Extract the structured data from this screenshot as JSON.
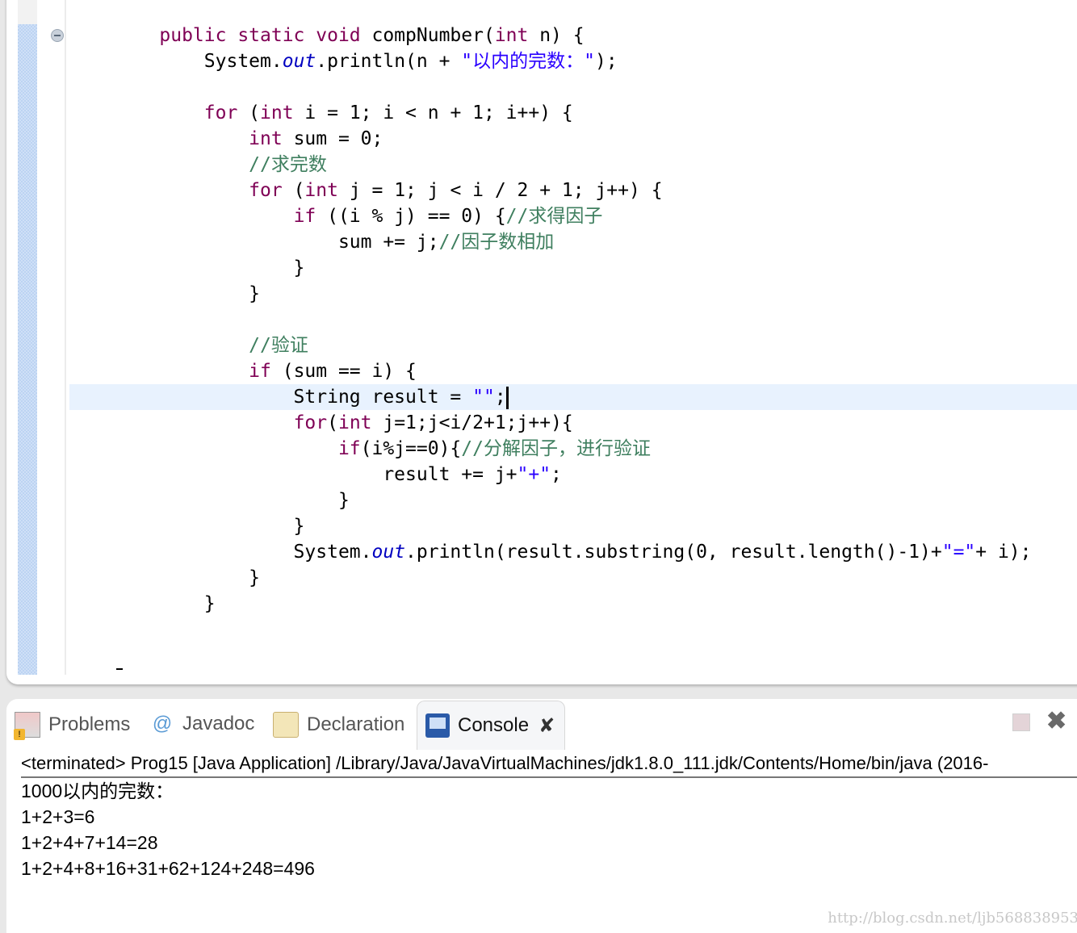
{
  "colors": {
    "keyword": "#7f0055",
    "string": "#2a00ff",
    "comment": "#3f7f5f",
    "field": "#0000c0",
    "current_line": "#e8f2fe"
  },
  "editor": {
    "current_line": 14,
    "lines": [
      [
        [
          "",
          "    "
        ],
        [
          "kw",
          "public static void"
        ],
        [
          "",
          " compNumber("
        ],
        [
          "kw",
          "int"
        ],
        [
          "",
          " n) {"
        ]
      ],
      [
        [
          "",
          "        System."
        ],
        [
          "fld",
          "out"
        ],
        [
          "",
          ".println(n + "
        ],
        [
          "str",
          "\"以内的完数：\""
        ],
        [
          "",
          ");"
        ]
      ],
      [],
      [
        [
          "",
          "        "
        ],
        [
          "kw",
          "for"
        ],
        [
          "",
          " ("
        ],
        [
          "kw",
          "int"
        ],
        [
          "",
          " i = 1; i < n + 1; i++) {"
        ]
      ],
      [
        [
          "",
          "            "
        ],
        [
          "kw",
          "int"
        ],
        [
          "",
          " sum = 0;"
        ]
      ],
      [
        [
          "",
          "            "
        ],
        [
          "cmt",
          "//求完数"
        ]
      ],
      [
        [
          "",
          "            "
        ],
        [
          "kw",
          "for"
        ],
        [
          "",
          " ("
        ],
        [
          "kw",
          "int"
        ],
        [
          "",
          " j = 1; j < i / 2 + 1; j++) {"
        ]
      ],
      [
        [
          "",
          "                "
        ],
        [
          "kw",
          "if"
        ],
        [
          "",
          " ((i % j) == 0) {"
        ],
        [
          "cmt",
          "//求得因子"
        ]
      ],
      [
        [
          "",
          "                    sum += j;"
        ],
        [
          "cmt",
          "//因子数相加"
        ]
      ],
      [
        [
          "",
          "                }"
        ]
      ],
      [
        [
          "",
          "            }"
        ]
      ],
      [],
      [
        [
          "",
          "            "
        ],
        [
          "cmt",
          "//验证"
        ]
      ],
      [
        [
          "",
          "            "
        ],
        [
          "kw",
          "if"
        ],
        [
          "",
          " (sum == i) {"
        ]
      ],
      [
        [
          "",
          "                String result = "
        ],
        [
          "str",
          "\"\""
        ],
        [
          "",
          ";"
        ]
      ],
      [
        [
          "",
          "                "
        ],
        [
          "kw",
          "for"
        ],
        [
          "",
          "("
        ],
        [
          "kw",
          "int"
        ],
        [
          "",
          " j=1;j<i/2+1;j++){"
        ]
      ],
      [
        [
          "",
          "                    "
        ],
        [
          "kw",
          "if"
        ],
        [
          "",
          "(i%j==0){"
        ],
        [
          "cmt",
          "//分解因子，进行验证"
        ]
      ],
      [
        [
          "",
          "                        result += j+"
        ],
        [
          "str",
          "\"+\""
        ],
        [
          "",
          ";"
        ]
      ],
      [
        [
          "",
          "                    }"
        ]
      ],
      [
        [
          "",
          "                }"
        ]
      ],
      [
        [
          "",
          "                System."
        ],
        [
          "fld",
          "out"
        ],
        [
          "",
          ".println(result.substring(0, result.length()-1)+"
        ],
        [
          "str",
          "\"=\""
        ],
        [
          "",
          "+ i);"
        ]
      ],
      [
        [
          "",
          "            }"
        ]
      ],
      [
        [
          "",
          "        }"
        ]
      ]
    ]
  },
  "panel": {
    "tabs": [
      {
        "label": "Problems",
        "icon": "problems-icon"
      },
      {
        "label": "Javadoc",
        "icon": "at-icon"
      },
      {
        "label": "Declaration",
        "icon": "declaration-icon"
      },
      {
        "label": "Console",
        "icon": "console-icon",
        "active": true
      }
    ],
    "console_header": "<terminated> Prog15 [Java Application] /Library/Java/JavaVirtualMachines/jdk1.8.0_111.jdk/Contents/Home/bin/java (2016-",
    "output": [
      "1000以内的完数：",
      "1+2+3=6",
      "1+2+4+7+14=28",
      "1+2+4+8+16+31+62+124+248=496"
    ]
  },
  "watermark": "http://blog.csdn.net/ljb568838953"
}
